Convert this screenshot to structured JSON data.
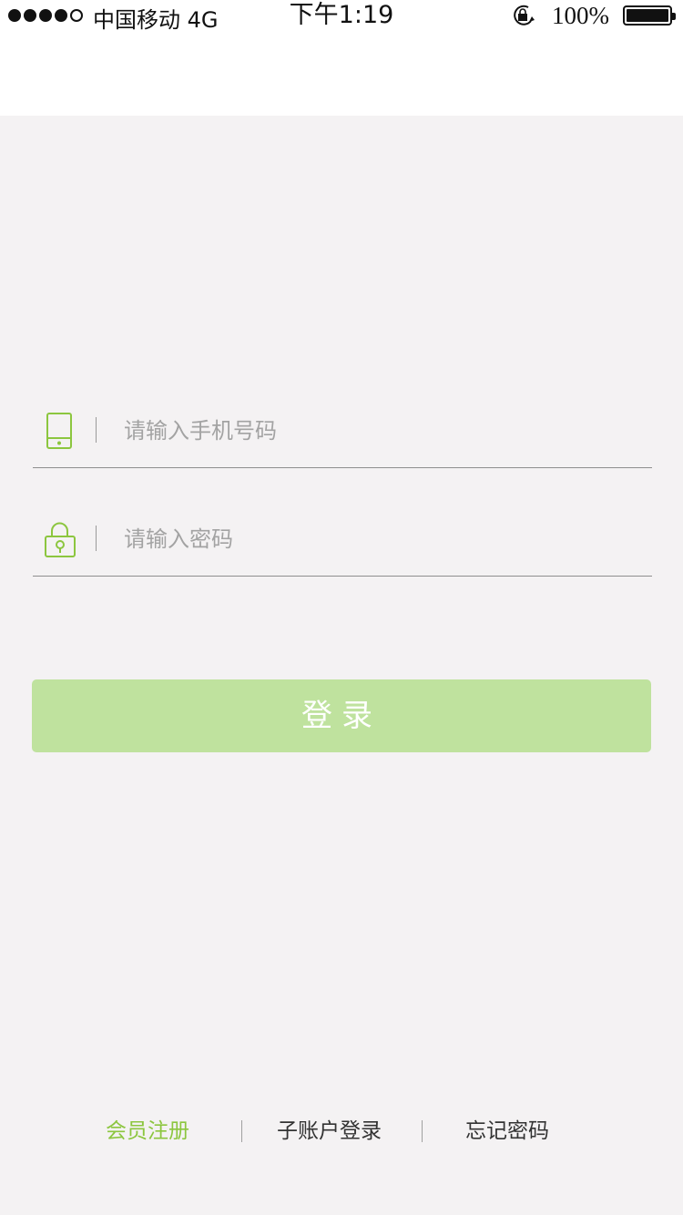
{
  "status_bar": {
    "carrier": "中国移动  4G",
    "time": "下午1:19",
    "battery": "100%",
    "signal_bars_filled": 4,
    "signal_bars_total": 5,
    "battery_level": 1.0
  },
  "form": {
    "phone": {
      "placeholder": "请输入手机号码",
      "value": "",
      "icon": "phone-icon"
    },
    "password": {
      "placeholder": "请输入密码",
      "value": "",
      "icon": "lock-icon"
    }
  },
  "login_button": {
    "label": "登录"
  },
  "footer": {
    "register": "会员注册",
    "sub_account": "子账户登录",
    "forgot_password": "忘记密码"
  },
  "colors": {
    "accent_green": "#8cc63f",
    "button_bg": "#bfe29e",
    "page_bg": "#f4f2f3",
    "header_bg": "#ffffff"
  }
}
